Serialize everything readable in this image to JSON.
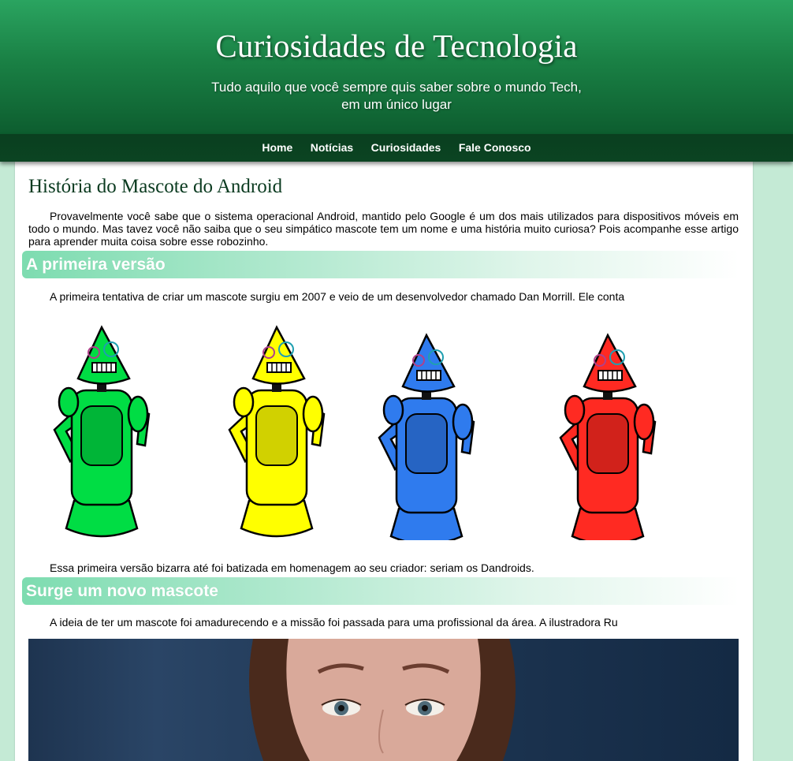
{
  "header": {
    "title": "Curiosidades de Tecnologia",
    "subtitle_line1": "Tudo aquilo que você sempre quis saber sobre o mundo Tech,",
    "subtitle_line2": "em um único lugar"
  },
  "nav": {
    "items": [
      {
        "label": "Home"
      },
      {
        "label": "Notícias"
      },
      {
        "label": "Curiosidades"
      },
      {
        "label": "Fale Conosco"
      }
    ]
  },
  "article": {
    "title": "História do Mascote do Android",
    "intro": "Provavelmente você sabe que o sistema operacional Android, mantido pelo Google é um dos mais utilizados para dispositivos móveis em todo o mundo. Mas tavez você não saiba que o seu simpático mascote tem um nome e uma história muito curiosa? Pois acompanhe esse artigo para aprender muita coisa sobre esse robozinho.",
    "sections": [
      {
        "heading": "A primeira versão",
        "text_before": "A primeira tentativa de criar um mascote surgiu em 2007 e veio de um desenvolvedor chamado Dan Morrill. Ele conta",
        "text_after": "Essa primeira versão bizarra até foi batizada em homenagem ao seu criador: seriam os Dandroids."
      },
      {
        "heading": "Surge um novo mascote",
        "text_before": "A ideia de ter um mascote foi amadurecendo e a missão foi passada para uma profissional da área. A ilustradora Ru"
      }
    ]
  },
  "robots": [
    {
      "color": "#00dd44",
      "name": "green-robot"
    },
    {
      "color": "#ffff00",
      "name": "yellow-robot"
    },
    {
      "color": "#2f7bee",
      "name": "blue-robot"
    },
    {
      "color": "#ff2a22",
      "name": "red-robot"
    }
  ],
  "colors": {
    "page_bg": "#c4ead5",
    "header_green": "#1a8145",
    "nav_dark": "#0a3f1f",
    "section_bar": "#7ddcb0"
  }
}
